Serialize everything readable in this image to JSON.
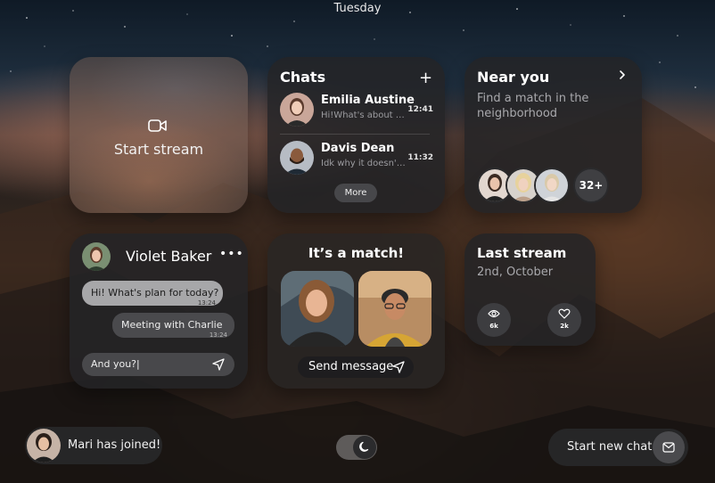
{
  "top_bar": {
    "day": "Tuesday"
  },
  "start_stream": {
    "label": "Start stream",
    "icon": "video-camera-icon"
  },
  "chats": {
    "title": "Chats",
    "add_icon": "plus-icon",
    "items": [
      {
        "name": "Emilia Austine",
        "preview": "Hi!What's about lun...",
        "time": "12:41"
      },
      {
        "name": "Davis Dean",
        "preview": "Idk why it doesn't w...",
        "time": "11:32"
      }
    ],
    "more_label": "More"
  },
  "near_you": {
    "title": "Near you",
    "subtitle": "Find a match in the neighborhood",
    "arrow_icon": "chevron-right-icon",
    "extra_count": "32+"
  },
  "conversation": {
    "contact_name": "Violet Baker",
    "menu_icon": "more-dots-icon",
    "messages": [
      {
        "text": "Hi! What's plan for today?",
        "time": "13:24",
        "direction": "incoming"
      },
      {
        "text": "Meeting with Charlie",
        "time": "13:24",
        "direction": "outgoing"
      }
    ],
    "input_value": "And you?|",
    "send_icon": "send-icon"
  },
  "match": {
    "title": "It’s a match!",
    "send_label": "Send message",
    "send_icon": "send-icon"
  },
  "last_stream": {
    "title": "Last stream",
    "date": "2nd, October",
    "views": "6k",
    "likes": "2k",
    "views_icon": "eye-icon",
    "likes_icon": "heart-icon"
  },
  "notification": {
    "text": "Mari has joined!"
  },
  "theme_toggle": {
    "icon": "moon-icon",
    "state": "dark"
  },
  "new_chat": {
    "label": "Start new chat",
    "icon": "message-icon"
  },
  "colors": {
    "card": "#242426",
    "bubble_in": "#a7a7a9",
    "bubble_out": "#4a4a4d",
    "muted_text": "#a9a9ad"
  }
}
